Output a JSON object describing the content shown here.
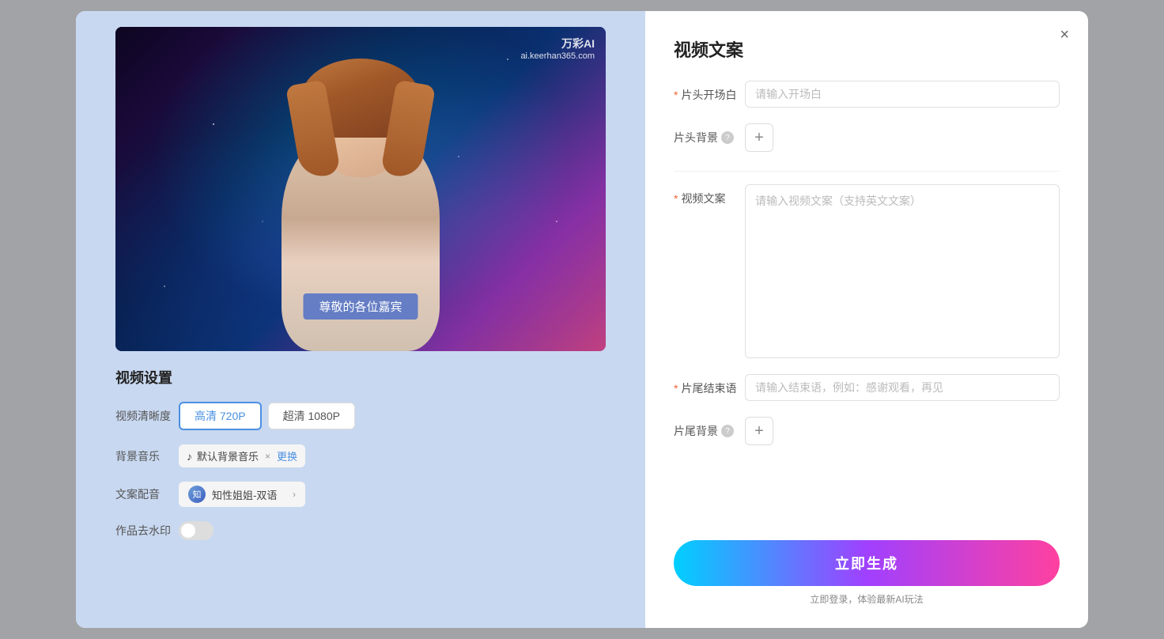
{
  "modal": {
    "close_label": "×"
  },
  "right_panel": {
    "title": "视频文案",
    "form": {
      "opening_label": "片头开场白",
      "opening_placeholder": "请输入开场白",
      "bg_label": "片头背景",
      "bg_help": "?",
      "script_label": "视频文案",
      "script_placeholder": "请输入视频文案（支持英文文案）",
      "ending_label": "片尾结束语",
      "ending_placeholder": "请输入结束语，例如：感谢观看，再见",
      "ending_bg_label": "片尾背景",
      "ending_bg_help": "?",
      "add_icon": "+"
    },
    "generate_btn": "立即生成",
    "login_hint_prefix": "立即登录，体验最新AI玩法",
    "login_link": ""
  },
  "left_panel": {
    "subtitle": "尊敬的各位嘉宾",
    "watermark_logo": "万彩AI",
    "watermark_url": "ai.keerhan365.com",
    "settings_title": "视频设置",
    "quality_label": "视频清晰度",
    "quality_options": [
      {
        "label": "高清 720P",
        "active": true
      },
      {
        "label": "超清 1080P",
        "active": false
      }
    ],
    "music_label": "背景音乐",
    "music_name": "默认背景音乐",
    "music_change": "更换",
    "voice_label": "文案配音",
    "voice_name": "知性姐姐-双语",
    "watermark_label": "作品去水印"
  }
}
